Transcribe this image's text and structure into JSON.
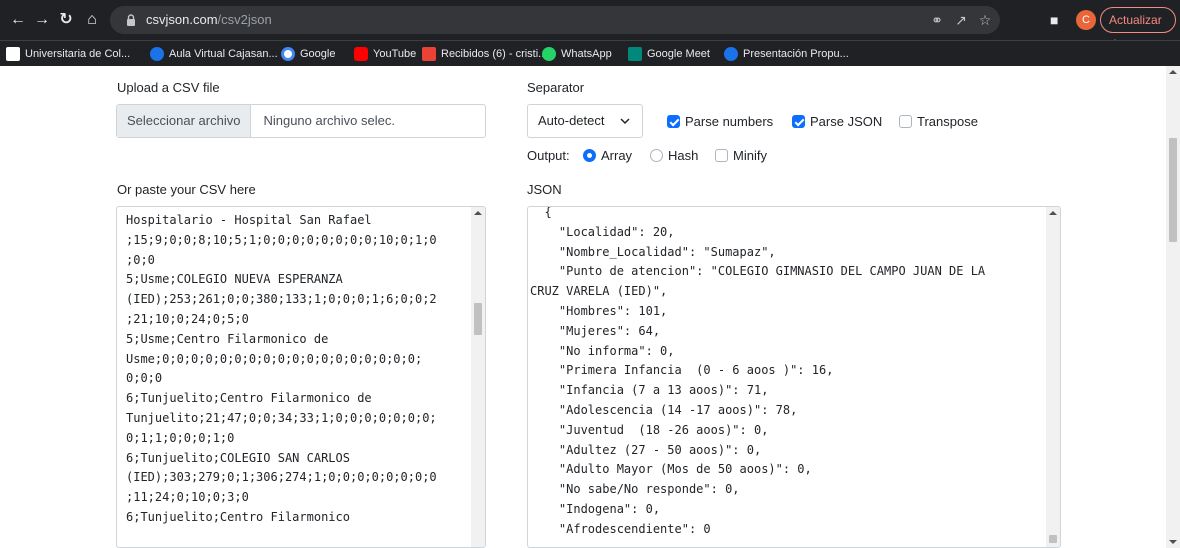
{
  "browser": {
    "url_domain": "csvjson.com",
    "url_path": "/csv2json",
    "avatar_letter": "C",
    "update_label": "Actualizar",
    "bookmarks": [
      {
        "label": "Universitaria de Col...",
        "color": "#ffffff"
      },
      {
        "label": "Aula Virtual Cajasan...",
        "color": "#1a73e8"
      },
      {
        "label": "Google",
        "color": "#ffffff"
      },
      {
        "label": "YouTube",
        "color": "#ff0000"
      },
      {
        "label": "Recibidos (6) - cristi...",
        "color": "#ea4335"
      },
      {
        "label": "WhatsApp",
        "color": "#25d366"
      },
      {
        "label": "Google Meet",
        "color": "#00897b"
      },
      {
        "label": "Presentación Propu...",
        "color": "#1a73e8"
      }
    ]
  },
  "upload": {
    "label": "Upload a CSV file",
    "button_label": "Seleccionar archivo",
    "file_name": "Ninguno archivo selec."
  },
  "separator": {
    "label": "Separator",
    "selected": "Auto-detect"
  },
  "options": {
    "parse_numbers": {
      "label": "Parse numbers",
      "checked": true
    },
    "parse_json": {
      "label": "Parse JSON",
      "checked": true
    },
    "transpose": {
      "label": "Transpose",
      "checked": false
    },
    "output_label": "Output:",
    "array": {
      "label": "Array",
      "selected": true
    },
    "hash": {
      "label": "Hash",
      "selected": false
    },
    "minify": {
      "label": "Minify",
      "checked": false
    }
  },
  "csv": {
    "label": "Or paste your CSV here",
    "text": "Hospitalario - Hospital San Rafael\n;15;9;0;0;8;10;5;1;0;0;0;0;0;0;0;0;10;0;1;0\n;0;0\n5;Usme;COLEGIO NUEVA ESPERANZA\n(IED);253;261;0;0;380;133;1;0;0;0;1;6;0;0;2\n;21;10;0;24;0;5;0\n5;Usme;Centro Filarmonico de\nUsme;0;0;0;0;0;0;0;0;0;0;0;0;0;0;0;0;0;0;\n0;0;0\n6;Tunjuelito;Centro Filarmonico de\nTunjuelito;21;47;0;0;34;33;1;0;0;0;0;0;0;0;\n0;1;1;0;0;0;1;0\n6;Tunjuelito;COLEGIO SAN CARLOS\n(IED);303;279;0;1;306;274;1;0;0;0;0;0;0;0;0\n;11;24;0;10;0;3;0\n6;Tunjuelito;Centro Filarmonico"
  },
  "json": {
    "label": "JSON",
    "text": "  {\n    \"Localidad\": 20,\n    \"Nombre_Localidad\": \"Sumapaz\",\n    \"Punto de atencion\": \"COLEGIO GIMNASIO DEL CAMPO JUAN DE LA\nCRUZ VARELA (IED)\",\n    \"Hombres\": 101,\n    \"Mujeres\": 64,\n    \"No informa\": 0,\n    \"Primera Infancia  (0 - 6 aoos )\": 16,\n    \"Infancia (7 a 13 aoos)\": 71,\n    \"Adolescencia (14 -17 aoos)\": 78,\n    \"Juventud  (18 -26 aoos)\": 0,\n    \"Adultez (27 - 50 aoos)\": 0,\n    \"Adulto Mayor (Mos de 50 aoos)\": 0,\n    \"No sabe/No responde\": 0,\n    \"Indogena\": 0,\n    \"Afrodescendiente\": 0"
  }
}
